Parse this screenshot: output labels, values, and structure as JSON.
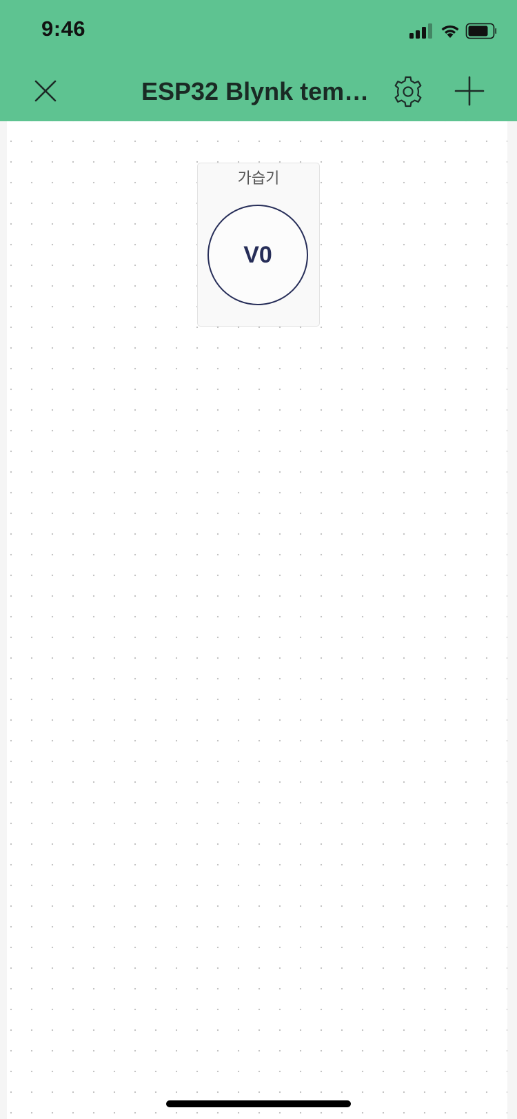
{
  "status_bar": {
    "time": "9:46",
    "icons": [
      "cellular-signal-icon",
      "wifi-icon",
      "battery-icon"
    ]
  },
  "nav": {
    "title": "ESP32 Blynk temp...",
    "left_icon": "close-icon",
    "right_icons": [
      "gear-icon",
      "plus-icon"
    ]
  },
  "widgets": [
    {
      "label": "가습기",
      "button_text": "V0"
    }
  ],
  "colors": {
    "header_bg": "#5ec391",
    "widget_accent": "#262d58",
    "canvas_bg": "#ffffff"
  }
}
